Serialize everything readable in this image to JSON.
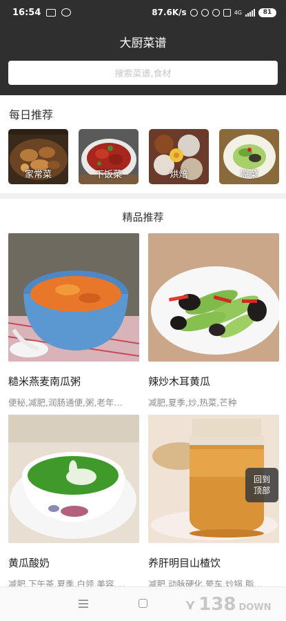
{
  "status_bar": {
    "time": "16:54",
    "net_speed": "87.6K/s",
    "network": "4G",
    "battery": "81"
  },
  "header": {
    "title": "大厨菜谱",
    "search_placeholder": "搜索菜谱,食材"
  },
  "daily": {
    "title": "每日推荐",
    "categories": [
      {
        "label": "家常菜"
      },
      {
        "label": "下饭菜"
      },
      {
        "label": "烘焙"
      },
      {
        "label": "凉菜"
      }
    ]
  },
  "featured": {
    "title": "精品推荐",
    "recipes": [
      {
        "name": "糙米燕麦南瓜粥",
        "tags": "便秘,减肥,润肠通便,粥,老年…"
      },
      {
        "name": "辣炒木耳黄瓜",
        "tags": "减肥,夏季,炒,热菜,芒种"
      },
      {
        "name": "黄瓜酸奶",
        "tags": "减肥,下午茶,夏季,白领,美容,…"
      },
      {
        "name": "养肝明目山楂饮",
        "tags": "减肥,动脉硬化,晕车,炒锅,脂…"
      }
    ]
  },
  "back_to_top": {
    "line1": "回到",
    "line2": "顶部"
  },
  "watermark": {
    "number": "138",
    "suffix": "DOWN"
  },
  "colors": {
    "header_bg": "#2f2f2f",
    "tag_gray": "#8d8d8d"
  }
}
